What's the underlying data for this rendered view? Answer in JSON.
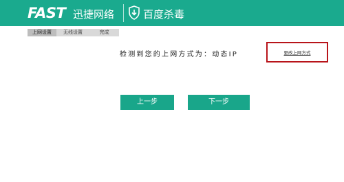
{
  "header": {
    "brand": "FAST",
    "brand_cn": "迅捷网络",
    "partner": "百度杀毒",
    "shield_icon": "baidu-antivirus-shield-icon",
    "bg_color": "#1aaa8e"
  },
  "steps": [
    "上网设置",
    "无线设置",
    "完成"
  ],
  "main": {
    "detect_text": "检测到您的上网方式为：动态IP",
    "change_link": "更改上网方式",
    "highlight_color": "#b8141a"
  },
  "buttons": {
    "prev": "上一步",
    "next": "下一步",
    "color": "#19a68a"
  }
}
